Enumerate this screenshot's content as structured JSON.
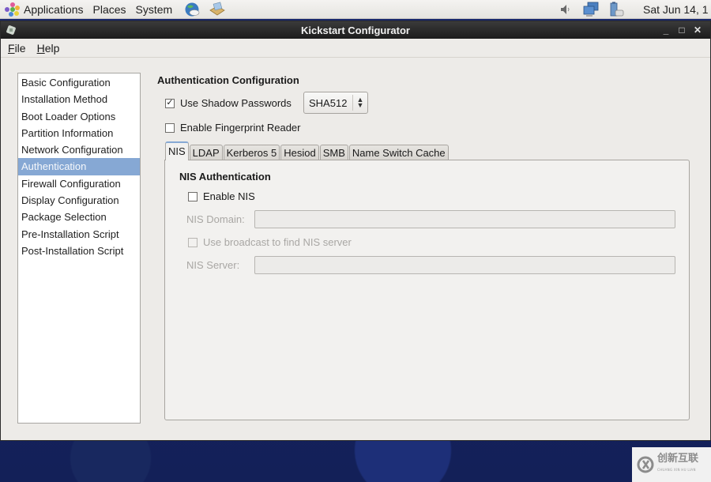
{
  "top_panel": {
    "menus": [
      "Applications",
      "Places",
      "System"
    ],
    "launchers": [
      {
        "icon": "web-browser-icon"
      },
      {
        "icon": "mail-client-icon"
      }
    ],
    "tray": [
      {
        "icon": "volume-icon"
      },
      {
        "icon": "network-icon"
      },
      {
        "icon": "battery-power-icon"
      }
    ],
    "clock": "Sat Jun 14, 1"
  },
  "window": {
    "title": "Kickstart Configurator",
    "menubar": [
      {
        "label": "File",
        "mnemonic": "F",
        "rest": "ile"
      },
      {
        "label": "Help",
        "mnemonic": "H",
        "rest": "elp"
      }
    ],
    "controls": {
      "minimize": "_",
      "maximize": "□",
      "close": "✕"
    }
  },
  "sidebar": {
    "selected": "Authentication",
    "items": [
      "Basic Configuration",
      "Installation Method",
      "Boot Loader Options",
      "Partition Information",
      "Network Configuration",
      "Authentication",
      "Firewall Configuration",
      "Display Configuration",
      "Package Selection",
      "Pre-Installation Script",
      "Post-Installation Script"
    ]
  },
  "auth": {
    "section_title": "Authentication Configuration",
    "shadow_passwords": {
      "label": "Use Shadow Passwords",
      "checked": true
    },
    "hash_algorithm": {
      "value": "SHA512"
    },
    "fingerprint": {
      "label": "Enable Fingerprint Reader",
      "checked": false
    },
    "tabs": [
      "NIS",
      "LDAP",
      "Kerberos 5",
      "Hesiod",
      "SMB",
      "Name Switch Cache"
    ],
    "active_tab": "NIS",
    "nis": {
      "title": "NIS Authentication",
      "enable": {
        "label": "Enable NIS",
        "checked": false
      },
      "domain_label": "NIS Domain:",
      "domain_value": "",
      "broadcast": {
        "label": "Use broadcast to find NIS server",
        "checked": false
      },
      "server_label": "NIS Server:",
      "server_value": ""
    }
  },
  "watermark": {
    "text": "创新互联",
    "subtext": "CHUANG XIN HU LIAN"
  },
  "colors": {
    "selection": "#86a8d4",
    "titlebar": "#262626",
    "desktop": "#14215a",
    "window_bg": "#edebe8"
  }
}
